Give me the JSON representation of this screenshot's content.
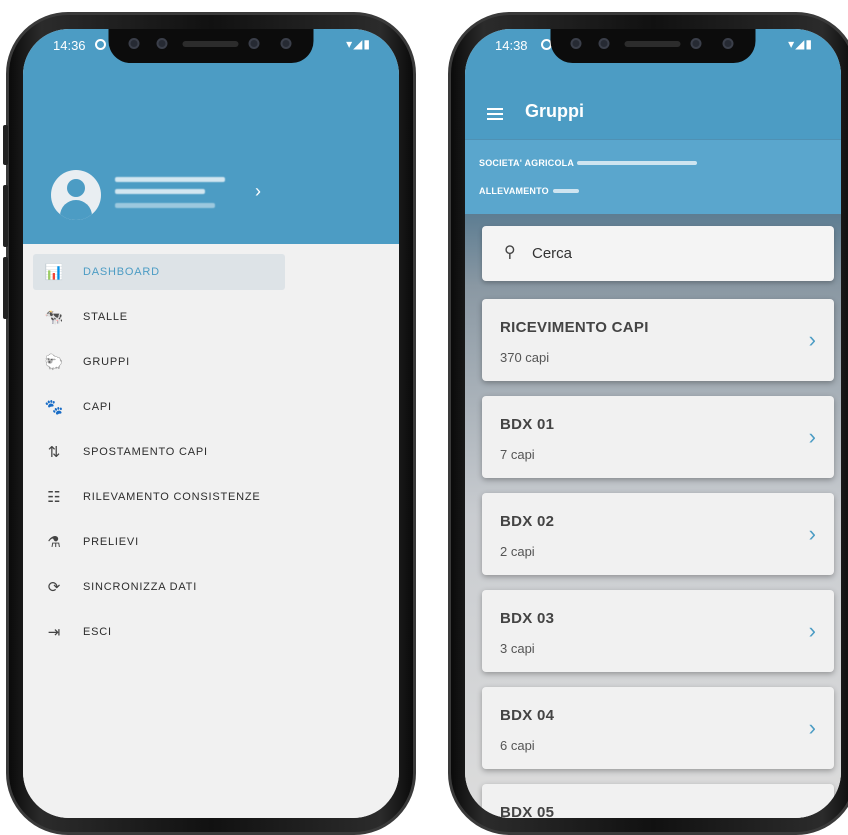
{
  "left_phone": {
    "status": {
      "time": "14:36",
      "network": "▾◢▮"
    },
    "drawer": {
      "menu": [
        {
          "label": "DASHBOARD",
          "icon": "bar-chart-icon",
          "glyph": "📊",
          "active": true
        },
        {
          "label": "STALLE",
          "icon": "barn-icon",
          "glyph": "🐄",
          "active": false
        },
        {
          "label": "GRUPPI",
          "icon": "herd-icon",
          "glyph": "🐑",
          "active": false
        },
        {
          "label": "CAPI",
          "icon": "paw-icon",
          "glyph": "🐾",
          "active": false
        },
        {
          "label": "SPOSTAMENTO CAPI",
          "icon": "move-animals-icon",
          "glyph": "⇅",
          "active": false
        },
        {
          "label": "RILEVAMENTO CONSISTENZE",
          "icon": "survey-icon",
          "glyph": "☷",
          "active": false
        },
        {
          "label": "PRELIEVI",
          "icon": "sample-icon",
          "glyph": "⚗",
          "active": false
        },
        {
          "label": "SINCRONIZZA DATI",
          "icon": "sync-icon",
          "glyph": "⟳",
          "active": false
        },
        {
          "label": "ESCI",
          "icon": "logout-icon",
          "glyph": "⇥",
          "active": false
        }
      ],
      "header_chevron": "›"
    }
  },
  "right_phone": {
    "status": {
      "time": "14:38",
      "network": "▾◢▮"
    },
    "appbar": {
      "title": "Gruppi"
    },
    "info": {
      "company_label": "SOCIETA' AGRICOLA",
      "farm_label": "ALLEVAMENTO"
    },
    "search": {
      "placeholder": "Cerca"
    },
    "groups": [
      {
        "name": "RICEVIMENTO CAPI",
        "count": "370 capi"
      },
      {
        "name": "BDX 01",
        "count": "7 capi"
      },
      {
        "name": "BDX 02",
        "count": "2 capi"
      },
      {
        "name": "BDX 03",
        "count": "3 capi"
      },
      {
        "name": "BDX 04",
        "count": "6 capi"
      },
      {
        "name": "BDX 05",
        "count": ""
      }
    ],
    "chevron": "›"
  },
  "colors": {
    "primary": "#4c9cc4",
    "background": "#f1f1f1"
  }
}
